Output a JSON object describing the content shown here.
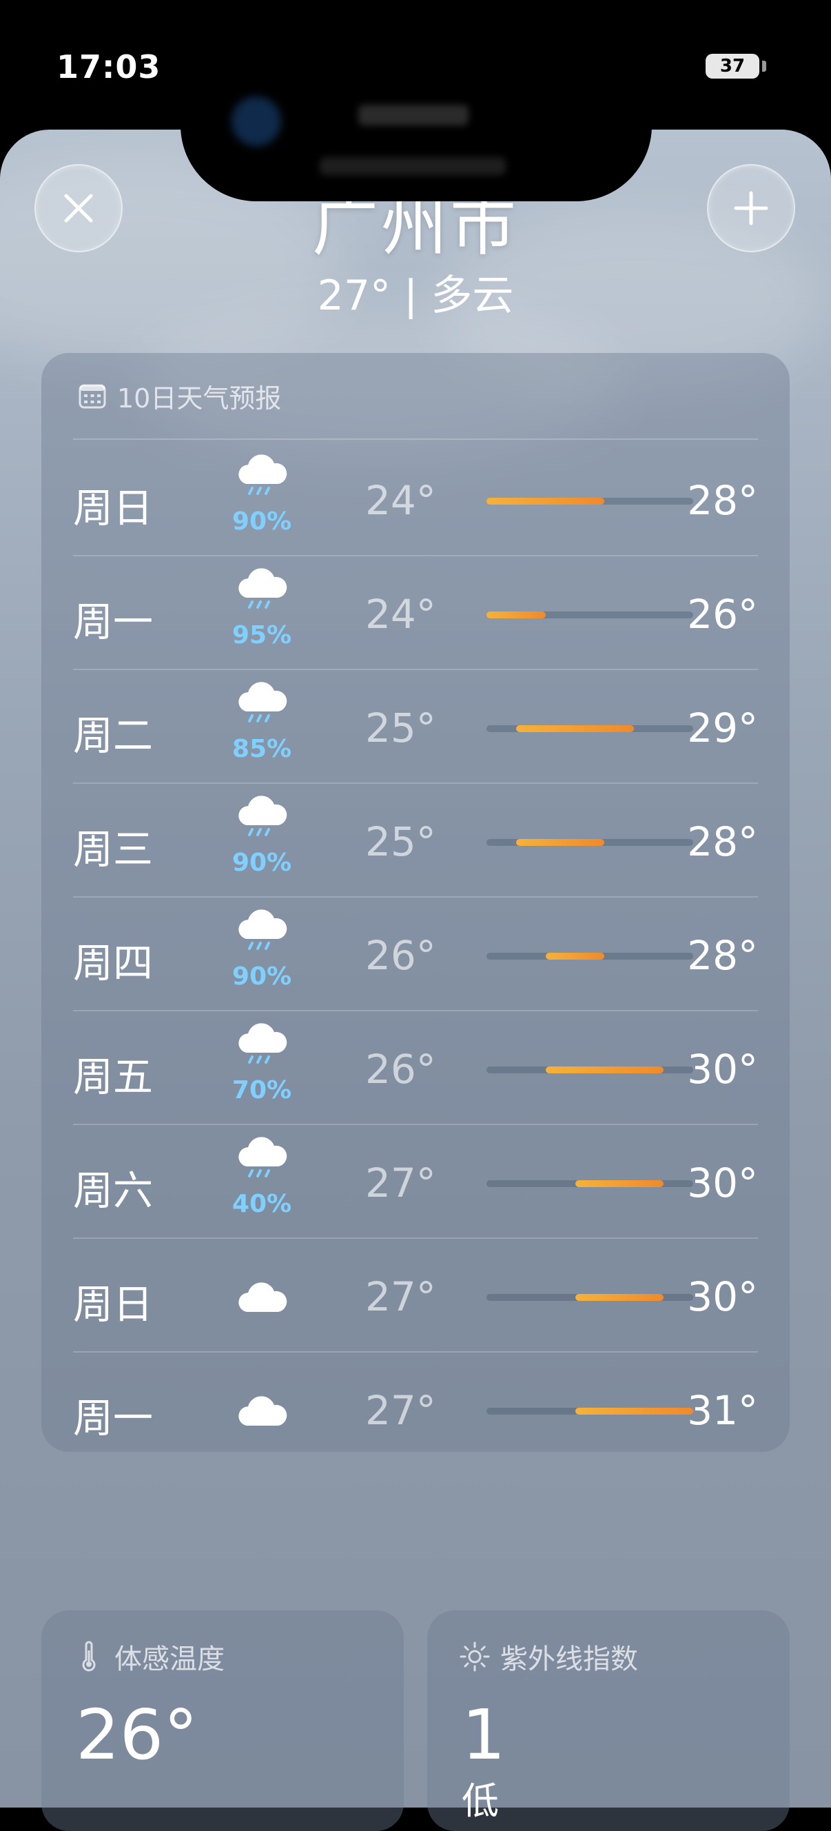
{
  "status_bar": {
    "time": "17:03",
    "battery": "37"
  },
  "header": {
    "city": "广州市",
    "current": "27° | 多云"
  },
  "forecast": {
    "title": "10日天气预报",
    "scale_min": 24,
    "scale_max": 31,
    "days": [
      {
        "day": "周日",
        "icon": "cloud-rain-icon",
        "precip": "90%",
        "low": "24°",
        "high": "28°",
        "low_value": 24,
        "high_value": 28
      },
      {
        "day": "周一",
        "icon": "cloud-rain-icon",
        "precip": "95%",
        "low": "24°",
        "high": "26°",
        "low_value": 24,
        "high_value": 26
      },
      {
        "day": "周二",
        "icon": "cloud-rain-icon",
        "precip": "85%",
        "low": "25°",
        "high": "29°",
        "low_value": 25,
        "high_value": 29
      },
      {
        "day": "周三",
        "icon": "cloud-rain-icon",
        "precip": "90%",
        "low": "25°",
        "high": "28°",
        "low_value": 25,
        "high_value": 28
      },
      {
        "day": "周四",
        "icon": "cloud-rain-icon",
        "precip": "90%",
        "low": "26°",
        "high": "28°",
        "low_value": 26,
        "high_value": 28
      },
      {
        "day": "周五",
        "icon": "cloud-rain-icon",
        "precip": "70%",
        "low": "26°",
        "high": "30°",
        "low_value": 26,
        "high_value": 30
      },
      {
        "day": "周六",
        "icon": "cloud-rain-icon",
        "precip": "40%",
        "low": "27°",
        "high": "30°",
        "low_value": 27,
        "high_value": 30
      },
      {
        "day": "周日",
        "icon": "cloud-icon",
        "precip": "",
        "low": "27°",
        "high": "30°",
        "low_value": 27,
        "high_value": 30
      },
      {
        "day": "周一",
        "icon": "cloud-icon",
        "precip": "",
        "low": "27°",
        "high": "31°",
        "low_value": 27,
        "high_value": 31
      }
    ]
  },
  "feels_like": {
    "title": "体感温度",
    "value": "26°"
  },
  "uv": {
    "title": "紫外线指数",
    "value": "1",
    "level": "低"
  },
  "colors": {
    "bar_cool": "#f5b23a",
    "bar_warm": "#f08a2c",
    "precip": "#7fd0ff"
  }
}
